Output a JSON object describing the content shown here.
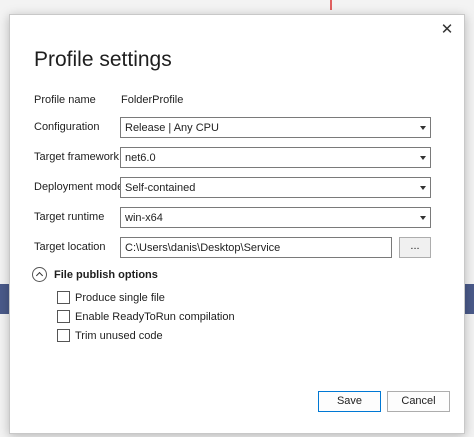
{
  "dialog": {
    "title": "Profile settings",
    "close_glyph": "✕",
    "fields": {
      "profile_name": {
        "label": "Profile name",
        "value": "FolderProfile"
      },
      "configuration": {
        "label": "Configuration",
        "value": "Release | Any CPU"
      },
      "target_framework": {
        "label": "Target framework",
        "value": "net6.0"
      },
      "deployment_mode": {
        "label": "Deployment mode",
        "value": "Self-contained"
      },
      "target_runtime": {
        "label": "Target runtime",
        "value": "win-x64"
      },
      "target_location": {
        "label": "Target location",
        "value": "C:\\Users\\danis\\Desktop\\Service",
        "browse_label": "..."
      }
    },
    "publish_options": {
      "title": "File publish options",
      "options": [
        {
          "label": "Produce single file",
          "checked": false
        },
        {
          "label": "Enable ReadyToRun compilation",
          "checked": false
        },
        {
          "label": "Trim unused code",
          "checked": false
        }
      ]
    },
    "buttons": {
      "save": "Save",
      "cancel": "Cancel"
    },
    "colors": {
      "accent": "#0078d4",
      "border": "#7a7a7a"
    }
  }
}
